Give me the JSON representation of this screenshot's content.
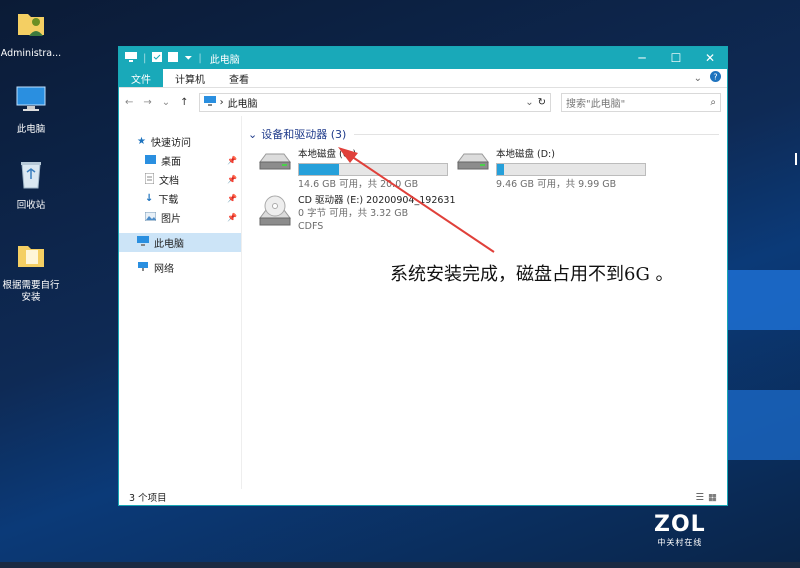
{
  "desktop": {
    "icons": [
      {
        "label": "Administra...",
        "icon": "user-folder-icon"
      },
      {
        "label": "此电脑",
        "icon": "computer-icon"
      },
      {
        "label": "回收站",
        "icon": "recycle-bin-icon"
      },
      {
        "label": "根据需要自行安装",
        "icon": "folder-icon"
      }
    ]
  },
  "window": {
    "title": "此电脑",
    "controls": {
      "minimize": "─",
      "maximize": "☐",
      "close": "✕"
    },
    "ribbon_tabs": [
      "文件",
      "计算机",
      "查看"
    ],
    "address": {
      "path": "此电脑",
      "back": "←",
      "forward": "→",
      "dropdown": "⌄",
      "up": "↑"
    },
    "search": {
      "placeholder": "搜索\"此电脑\""
    },
    "nav": {
      "quick_access": "快速访问",
      "items": [
        "桌面",
        "文档",
        "下载",
        "图片"
      ],
      "this_pc": "此电脑",
      "network": "网络"
    },
    "group_header": "设备和驱动器 (3)",
    "drives": [
      {
        "name": "本地磁盘 (C:)",
        "detail": "14.6 GB 可用，共 20.0 GB",
        "used_fraction": 0.27
      },
      {
        "name": "本地磁盘 (D:)",
        "detail": "9.46 GB 可用，共 9.99 GB",
        "used_fraction": 0.05
      },
      {
        "name": "CD 驱动器 (E:) 20200904_192631",
        "detail": "0 字节 可用，共 3.32 GB",
        "fs": "CDFS"
      }
    ],
    "status": "3 个项目"
  },
  "annotation": {
    "text": "系统安装完成，磁盘占用不到6G 。",
    "arrow_color": "#e0403a"
  },
  "watermark": {
    "logo": "ZOL",
    "cn": "中关村在线"
  },
  "colors": {
    "accent": "#19a9b9",
    "bar": "#26a0da",
    "selection": "#cce4f7"
  }
}
